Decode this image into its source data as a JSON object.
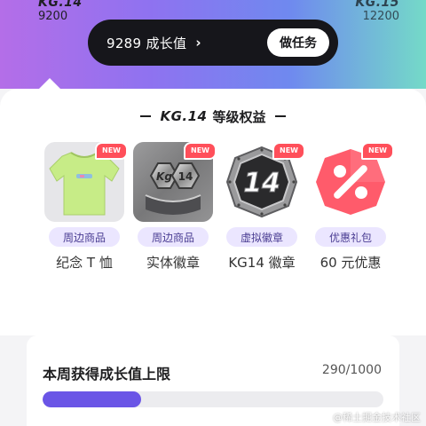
{
  "header": {
    "current_level": {
      "name": "KG.14",
      "points": "9200"
    },
    "next_level": {
      "name": "KG.15",
      "points": "12200"
    },
    "growth": {
      "text": "9289 成长值",
      "chevron": "›",
      "button_label": "做任务"
    }
  },
  "section": {
    "level_name": "KG.14",
    "title_suffix": "等级权益"
  },
  "rewards": [
    {
      "badge": "NEW",
      "tag": "周边商品",
      "label": "纪念 T 恤",
      "icon": "tshirt-icon"
    },
    {
      "badge": "NEW",
      "tag": "周边商品",
      "label": "实体徽章",
      "icon": "physical-badge-icon"
    },
    {
      "badge": "NEW",
      "tag": "虚拟徽章",
      "label": "KG14 徽章",
      "icon": "virtual-badge-icon"
    },
    {
      "badge": "NEW",
      "tag": "优惠礼包",
      "label": "60 元优惠",
      "icon": "percent-coupon-icon"
    }
  ],
  "weekly": {
    "title": "本周获得成长值上限",
    "count": "290/1000",
    "progress": 0.29
  },
  "watermark": "@稀土掘金技术社区",
  "colors": {
    "accent": "#6a55e6",
    "badge_new": "#ff4f5a",
    "tag_bg": "#ebe6ff",
    "pill_bg": "#16161b"
  }
}
